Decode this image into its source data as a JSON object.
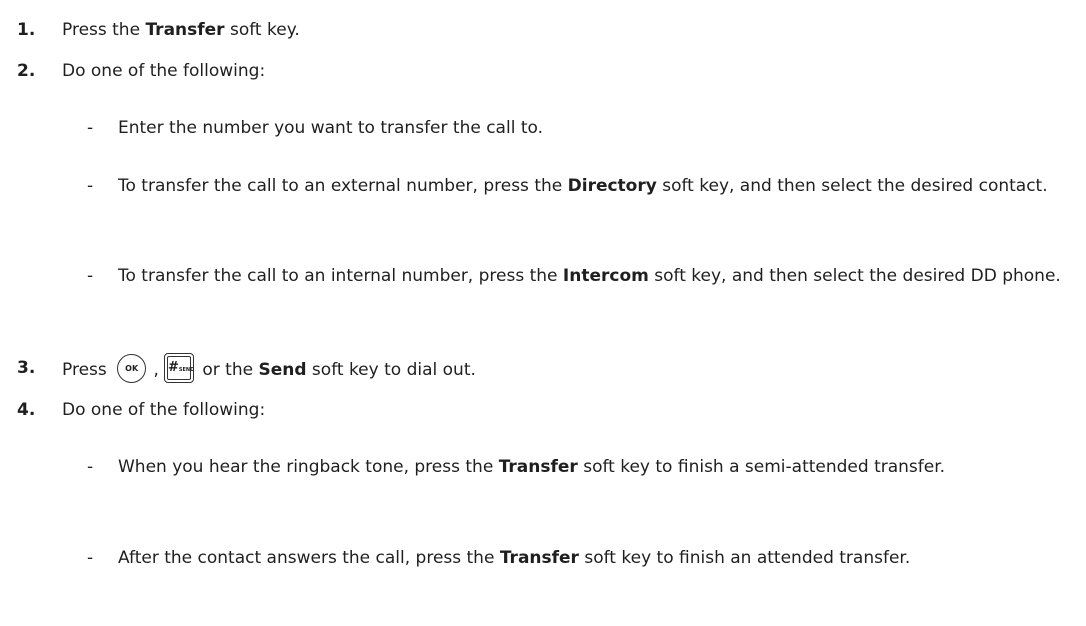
{
  "steps": [
    {
      "number": "1.",
      "before": "Press the ",
      "bold": "Transfer",
      "after": " soft key."
    },
    {
      "number": "2.",
      "text": "Do one of the following:",
      "subitems": [
        {
          "bullet": "-",
          "text": "Enter the number you want to transfer the call to."
        },
        {
          "bullet": "-",
          "before": "To transfer the call to an external number, press the ",
          "bold": "Directory",
          "after": " soft key, and then select the desired contact."
        },
        {
          "bullet": "-",
          "before": "To transfer the call to an internal number, press the ",
          "bold": "Intercom",
          "after": " soft key, and then select the desired DD phone."
        }
      ]
    },
    {
      "number": "3.",
      "before": "Press ",
      "key_ok": "OK",
      "separator": " ,",
      "key_send_symbol": "#",
      "key_send_sub": "SEND",
      "middle": " or the ",
      "bold": "Send",
      "after": " soft key to dial out."
    },
    {
      "number": "4.",
      "text": "Do one of the following:",
      "subitems": [
        {
          "bullet": "-",
          "before": "When you hear the ringback tone, press the ",
          "bold": "Transfer",
          "after": " soft key to finish a semi-attended transfer."
        },
        {
          "bullet": "-",
          "before": "After the contact answers the call, press the ",
          "bold": "Transfer",
          "after": " soft key to finish an attended transfer."
        }
      ]
    }
  ]
}
